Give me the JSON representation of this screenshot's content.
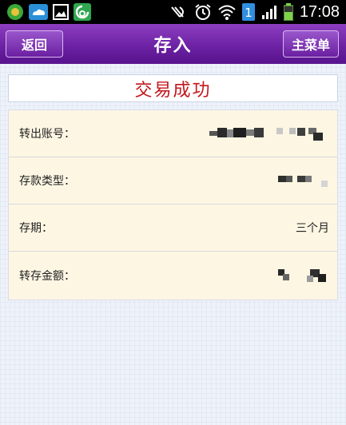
{
  "status_bar": {
    "time": "17:08",
    "icons": [
      "app-icon-green",
      "cloud-icon",
      "gallery-icon",
      "sync-icon",
      "nfc-icon",
      "alarm-icon",
      "wifi-icon",
      "sim-icon",
      "signal-icon",
      "battery-icon"
    ],
    "sim_number": "1"
  },
  "header": {
    "back_label": "返回",
    "title": "存入",
    "menu_label": "主菜单",
    "accent": "#6f23a6"
  },
  "banner": {
    "text": "交易成功",
    "color": "#c3161c"
  },
  "details": [
    {
      "label": "转出账号：",
      "value": ""
    },
    {
      "label": "存款类型：",
      "value": ""
    },
    {
      "label": "存期：",
      "value": "三个月"
    },
    {
      "label": "转存金额：",
      "value": ""
    }
  ]
}
